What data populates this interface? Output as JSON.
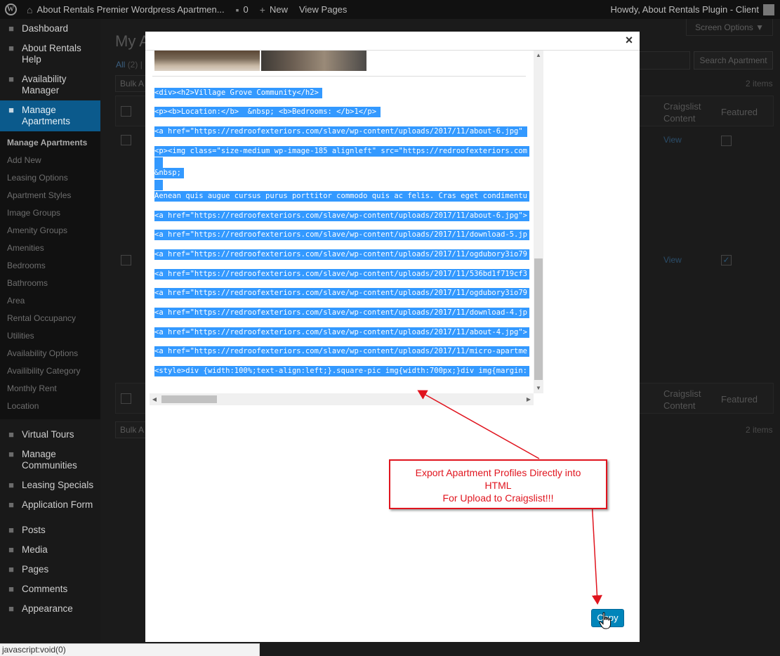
{
  "adminbar": {
    "site_name": "About Rentals Premier Wordpress Apartmen...",
    "comments_count": "0",
    "new_label": "New",
    "view_pages": "View Pages",
    "howdy": "Howdy, About Rentals Plugin - Client"
  },
  "sidebar": {
    "top": [
      {
        "label": "Dashboard",
        "icon": "dashboard-icon"
      },
      {
        "label": "About Rentals Help",
        "icon": "help-icon"
      },
      {
        "label": "Availability Manager",
        "icon": "availability-icon"
      },
      {
        "label": "Manage Apartments",
        "icon": "apartments-icon",
        "current": true
      }
    ],
    "submenu": [
      "Manage Apartments",
      "Add New",
      "Leasing Options",
      "Apartment Styles",
      "Image Groups",
      "Amenity Groups",
      "Amenities",
      "Bedrooms",
      "Bathrooms",
      "Area",
      "Rental Occupancy",
      "Utilities",
      "Availability Options",
      "Availibility Category",
      "Monthly Rent",
      "Location"
    ],
    "bottom": [
      {
        "label": "Virtual Tours",
        "icon": "tours-icon"
      },
      {
        "label": "Manage Communities",
        "icon": "communities-icon"
      },
      {
        "label": "Leasing Specials",
        "icon": "specials-icon"
      },
      {
        "label": "Application Form",
        "icon": "form-icon"
      }
    ],
    "wp": [
      {
        "label": "Posts",
        "icon": "posts-icon"
      },
      {
        "label": "Media",
        "icon": "media-icon"
      },
      {
        "label": "Pages",
        "icon": "pages-icon"
      },
      {
        "label": "Comments",
        "icon": "comments-icon"
      },
      {
        "label": "Appearance",
        "icon": "appearance-icon"
      }
    ]
  },
  "main": {
    "screen_options": "Screen Options ▼",
    "title": "My A",
    "views_all": "All",
    "views_count": "(2)",
    "search_button": "Search Apartment",
    "items_count": "2 items",
    "bulk_label": "Bulk A",
    "col_craigslist": "Craigslist Content",
    "col_featured": "Featured",
    "view_link": "View"
  },
  "modal": {
    "close": "×",
    "code_lines": [
      "<div><h2>Village Grove Community</h2>",
      "<p><b>Location:</b>  &nbsp; <b>Bedrooms: </b>1</p>",
      "<a href=\"https://redroofexteriors.com/slave/wp-content/uploads/2017/11/about-6.jpg\"",
      "<p><img class=\"size-medium wp-image-185 alignleft\" src=\"https://redroofexteriors.com",
      " ",
      "&nbsp;",
      " ",
      "Aenean quis augue cursus purus porttitor commodo quis ac felis. Cras eget condimentu",
      "<a href=\"https://redroofexteriors.com/slave/wp-content/uploads/2017/11/about-6.jpg\">",
      "<a href=\"https://redroofexteriors.com/slave/wp-content/uploads/2017/11/download-5.jp",
      "<a href=\"https://redroofexteriors.com/slave/wp-content/uploads/2017/11/ogdubory3io79",
      "<a href=\"https://redroofexteriors.com/slave/wp-content/uploads/2017/11/536bd1f719cf3",
      "<a href=\"https://redroofexteriors.com/slave/wp-content/uploads/2017/11/ogdubory3io79",
      "<a href=\"https://redroofexteriors.com/slave/wp-content/uploads/2017/11/download-4.jp",
      "<a href=\"https://redroofexteriors.com/slave/wp-content/uploads/2017/11/about-4.jpg\">",
      "<a href=\"https://redroofexteriors.com/slave/wp-content/uploads/2017/11/micro-apartme",
      "<style>div {width:100%;text-align:left;}.square-pic img{width:700px;}div img{margin:"
    ],
    "copy_button": "Copy"
  },
  "annotation": {
    "line1": "Export Apartment Profiles Directly into",
    "line2": "HTML",
    "line3": "For Upload to Craigslist!!!"
  },
  "statusbar": {
    "text": "javascript:void(0)"
  }
}
